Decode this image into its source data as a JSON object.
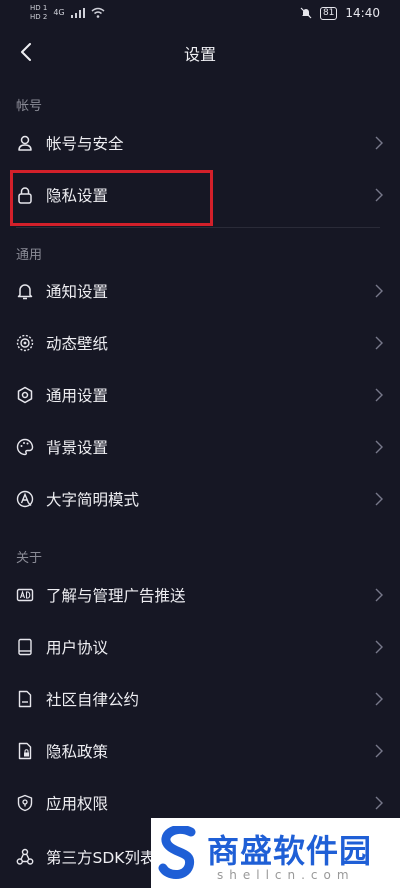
{
  "status_bar": {
    "sim1": "HD 1",
    "sim2": "HD 2",
    "network": "4G",
    "battery": "81",
    "time": "14:40"
  },
  "header": {
    "title": "设置"
  },
  "sections": {
    "account": "帐号",
    "general": "通用",
    "about": "关于"
  },
  "items": {
    "account_security": "帐号与安全",
    "privacy_settings": "隐私设置",
    "notification_settings": "通知设置",
    "live_wallpaper": "动态壁纸",
    "general_settings": "通用设置",
    "background_settings": "背景设置",
    "large_text_mode": "大字简明模式",
    "ad_management": "了解与管理广告推送",
    "user_agreement": "用户协议",
    "community_rules": "社区自律公约",
    "privacy_policy": "隐私政策",
    "app_permissions": "应用权限",
    "third_party_sdk": "第三方SDK列表"
  },
  "watermark": {
    "title": "商盛软件园",
    "subtitle": "shellcn.com"
  },
  "colors": {
    "background": "#161724",
    "highlight": "#d2202a",
    "watermark_blue": "#1f5fd6"
  },
  "icons": [
    "back-arrow-icon",
    "user-icon",
    "lock-icon",
    "bell-icon",
    "wallpaper-icon",
    "gear-icon",
    "palette-icon",
    "large-text-icon",
    "ad-icon",
    "book-icon",
    "document-icon",
    "document-lock-icon",
    "shield-icon",
    "sdk-icon",
    "chevron-right-icon"
  ]
}
